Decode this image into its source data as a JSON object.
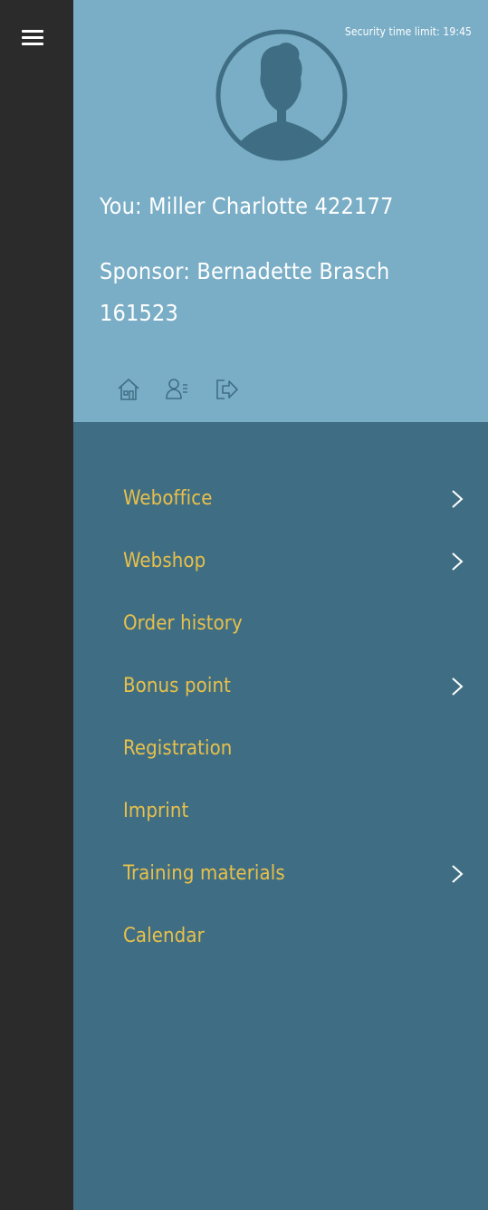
{
  "security": {
    "label": "Security time limit:",
    "time": "19:45"
  },
  "profile": {
    "you": "You: Miller Charlotte 422177",
    "sponsor_line1": "Sponsor: Bernadette Brasch",
    "sponsor_line2": "161523",
    "icons": [
      "home-icon",
      "user-list-icon",
      "logout-icon"
    ]
  },
  "menu": {
    "items": [
      {
        "label": "Weboffice",
        "has_submenu": true
      },
      {
        "label": "Webshop",
        "has_submenu": true
      },
      {
        "label": "Order history",
        "has_submenu": false
      },
      {
        "label": "Bonus point",
        "has_submenu": true
      },
      {
        "label": "Registration",
        "has_submenu": false
      },
      {
        "label": "Imprint",
        "has_submenu": false
      },
      {
        "label": "Training materials",
        "has_submenu": true
      },
      {
        "label": "Calendar",
        "has_submenu": false
      }
    ]
  },
  "colors": {
    "sidebar": "#2b2b2b",
    "profile_bg": "#7aaec6",
    "menu_bg": "#3f6e84",
    "menu_text": "#e8c04a",
    "avatar_dark": "#3f6e84"
  }
}
